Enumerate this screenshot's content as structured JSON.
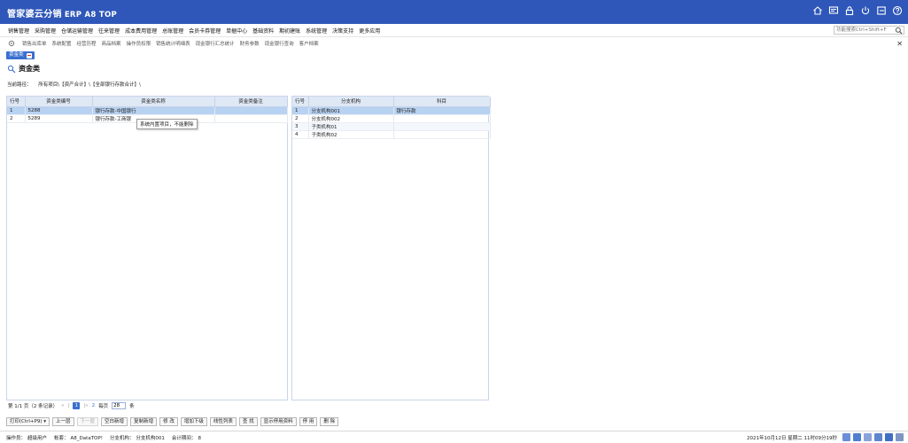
{
  "app": {
    "title": "管家婆云分销",
    "subtitle": "ERP A8 TOP",
    "header_icons": [
      "home-icon",
      "message-icon",
      "lock-icon",
      "power-icon",
      "logout-icon",
      "help-icon"
    ]
  },
  "menu": {
    "items": [
      "销售管理",
      "采购管理",
      "仓储运输管理",
      "往来管理",
      "成本费用管理",
      "总账管理",
      "会员卡券管理",
      "单据中心",
      "基础资料",
      "期初建账",
      "系统管理",
      "决策支持",
      "更多应用"
    ],
    "search_placeholder": "功能搜索Ctrl+Shift+F"
  },
  "quick": {
    "items": [
      "销售出库单",
      "系统配置",
      "经营历程",
      "商品档案",
      "操作员权限",
      "销售统计明细表",
      "现金银行汇总统计",
      "财务参数",
      "现金银行查询",
      "客户档案"
    ]
  },
  "tab": {
    "label": "资金类"
  },
  "page": {
    "title": "资金类",
    "breadcrumb_label": "当前路径：",
    "breadcrumb_path": "所有项目\\【资产合计】\\【全部银行存款合计】\\"
  },
  "left_grid": {
    "headers": [
      "行号",
      "资金类编号",
      "资金类名称",
      "资金类备注"
    ],
    "rows": [
      [
        "1",
        "5288",
        "银行存款-中国银行",
        ""
      ],
      [
        "2",
        "5289",
        "银行存款-工商银",
        ""
      ]
    ],
    "tooltip": "系统内置项目，不能删除"
  },
  "right_grid": {
    "headers": [
      "行号",
      "分支机构",
      "科目"
    ],
    "rows": [
      [
        "1",
        "分支机构001",
        "银行存款"
      ],
      [
        "2",
        "分支机构002",
        ""
      ],
      [
        "3",
        "子类机构01",
        ""
      ],
      [
        "4",
        "子类机构02",
        ""
      ]
    ]
  },
  "pager": {
    "page_info": "第 1/1 页（2 条记录）",
    "first": "«",
    "prev": "|",
    "current": "1",
    "next": "|»",
    "last": "2",
    "per_page_label": "每页",
    "per_page": "28",
    "per_page_unit": "条"
  },
  "toolbar": {
    "buttons": [
      "打印(Ctrl+P9) ▾",
      "上一层",
      "下一层",
      "空白新增",
      "复制新增",
      "修 改",
      "增加下级",
      "线性列表",
      "查 找",
      "显示停用资料",
      "停 用",
      "删 除"
    ],
    "disabled": [
      false,
      false,
      true,
      false,
      false,
      false,
      false,
      false,
      false,
      false,
      false,
      false
    ]
  },
  "status": {
    "operator_label": "操作员：",
    "operator": "超级用户",
    "account_label": "帐套：",
    "account": "A8_DataTOP!",
    "branch_label": "分支机构：",
    "branch": "分支机构001",
    "period_label": "会计期间：",
    "period": "8",
    "datetime": "2021年10月12日 星期二 11时09分19秒",
    "icons": [
      "calculator-icon",
      "calendar-icon",
      "notepad-icon",
      "keyboard-icon",
      "grid-icon",
      "user-group-icon"
    ],
    "icon_colors": [
      "#6a8fd8",
      "#4f7fcf",
      "#8aa4da",
      "#5e86cf",
      "#3f6fc4",
      "#7f95c5"
    ]
  },
  "colors": {
    "brand": "#2f57b9",
    "accent": "#3a6fd0",
    "selected_row": "#b8d2f2",
    "grid_header": "#dfe8f5"
  }
}
